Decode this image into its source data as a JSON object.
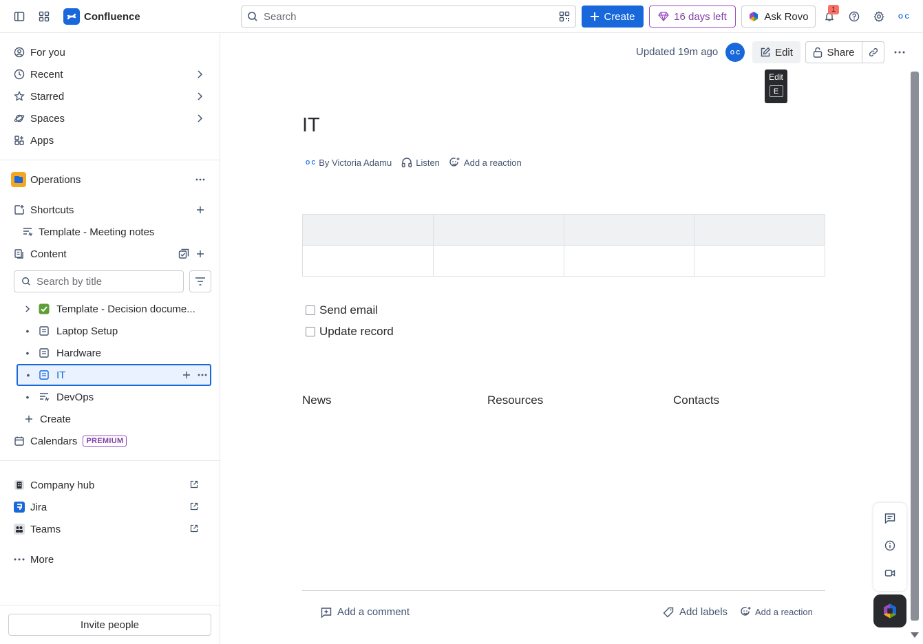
{
  "topbar": {
    "app_name": "Confluence",
    "search_placeholder": "Search",
    "create_label": "Create",
    "trial_label": "16 days left",
    "rovo_label": "Ask Rovo",
    "notification_count": "1",
    "user_initials": "O C"
  },
  "sidebar": {
    "nav": [
      {
        "label": "For you"
      },
      {
        "label": "Recent"
      },
      {
        "label": "Starred"
      },
      {
        "label": "Spaces"
      },
      {
        "label": "Apps"
      }
    ],
    "space_name": "Operations",
    "shortcuts_label": "Shortcuts",
    "shortcut_item": "Template - Meeting notes",
    "content_label": "Content",
    "search_placeholder": "Search by title",
    "tree": [
      {
        "label": "Template - Decision docume..."
      },
      {
        "label": "Laptop Setup"
      },
      {
        "label": "Hardware"
      },
      {
        "label": "IT"
      },
      {
        "label": "DevOps"
      }
    ],
    "create_label": "Create",
    "calendars_label": "Calendars",
    "premium_badge": "PREMIUM",
    "apps": [
      {
        "label": "Company hub"
      },
      {
        "label": "Jira"
      },
      {
        "label": "Teams"
      }
    ],
    "more_label": "More",
    "invite_label": "Invite people"
  },
  "page": {
    "updated": "Updated 19m ago",
    "avatar_initials": "O C",
    "edit_label": "Edit",
    "share_label": "Share",
    "tooltip_title": "Edit",
    "tooltip_key": "E",
    "title": "IT",
    "byline_author": "By Victoria Adamu",
    "byline_listen": "Listen",
    "byline_reaction": "Add a reaction",
    "tasks": [
      {
        "label": "Send email",
        "checked": false
      },
      {
        "label": "Update record",
        "checked": false
      }
    ],
    "columns": [
      "News",
      "Resources",
      "Contacts"
    ],
    "footer_comment": "Add a comment",
    "footer_labels": "Add labels",
    "footer_reaction": "Add a reaction"
  },
  "colors": {
    "accent": "#1868db",
    "trial": "#803fa5",
    "space_icon": "#f5a623",
    "badge": "#f87168"
  }
}
